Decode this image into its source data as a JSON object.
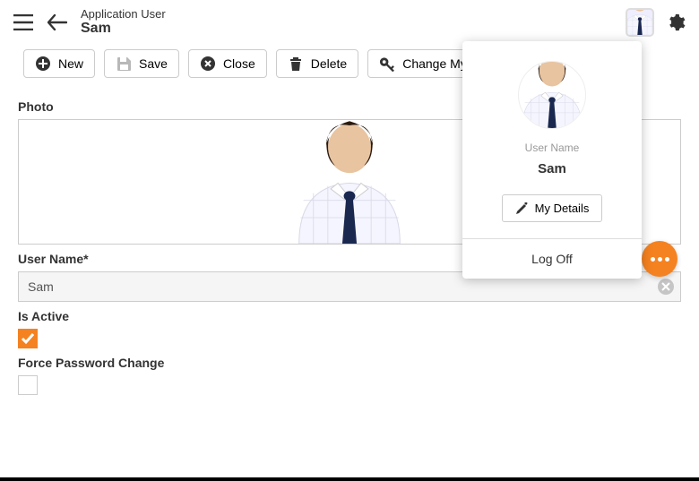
{
  "header": {
    "subtitle": "Application User",
    "title": "Sam"
  },
  "toolbar": {
    "new": "New",
    "save": "Save",
    "close": "Close",
    "delete": "Delete",
    "changePass": "Change My Password"
  },
  "form": {
    "photo_label": "Photo",
    "username_label": "User Name*",
    "username_value": "Sam",
    "isactive_label": "Is Active",
    "isactive_checked": true,
    "forcepwd_label": "Force Password Change",
    "forcepwd_checked": false
  },
  "popover": {
    "userlabel": "User Name",
    "username": "Sam",
    "details": "My Details",
    "logoff": "Log Off"
  },
  "colors": {
    "accent": "#f58220"
  }
}
